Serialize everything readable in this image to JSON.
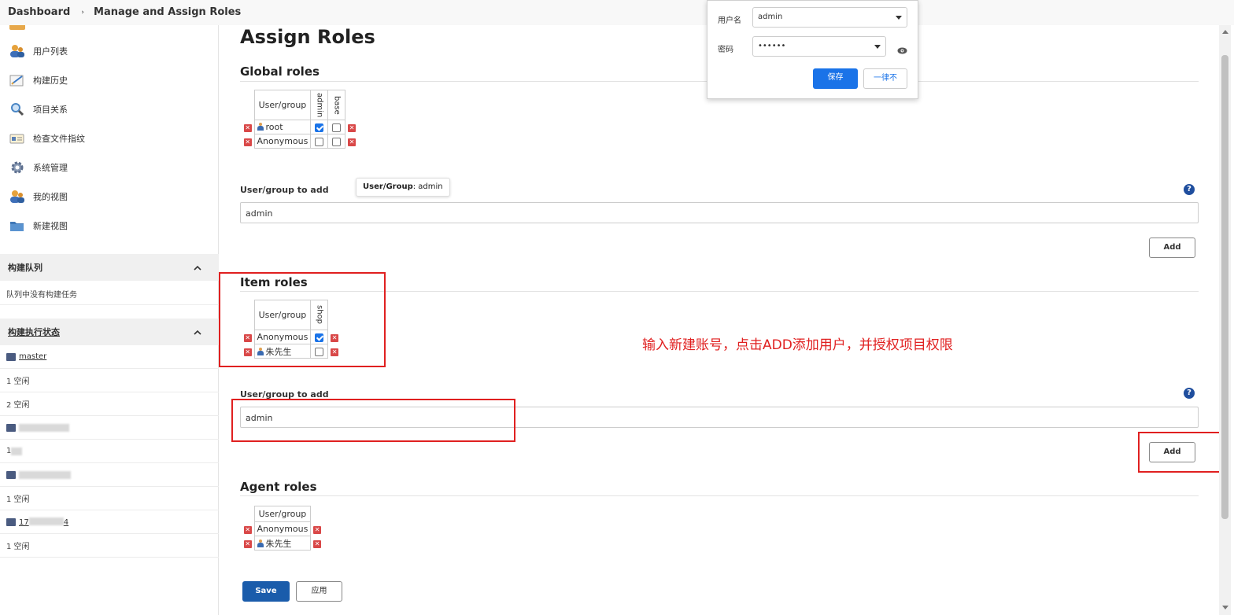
{
  "breadcrumb": {
    "dashboard": "Dashboard",
    "separator": "›",
    "current": "Manage and Assign Roles"
  },
  "sidebar": {
    "nav": [
      {
        "label": "用户列表",
        "icon": "users-icon"
      },
      {
        "label": "构建历史",
        "icon": "notepad-icon"
      },
      {
        "label": "项目关系",
        "icon": "search-icon"
      },
      {
        "label": "检查文件指纹",
        "icon": "fingerprint-icon"
      },
      {
        "label": "系统管理",
        "icon": "gear-icon"
      },
      {
        "label": "我的视图",
        "icon": "users-icon"
      },
      {
        "label": "新建视图",
        "icon": "folder-icon"
      }
    ],
    "build_queue": {
      "title": "构建队列",
      "empty": "队列中没有构建任务"
    },
    "executors": {
      "title": "构建执行状态",
      "master": "master",
      "rows": [
        "1 空闲",
        "2 空闲",
        "1 ",
        "1 空闲",
        "17",
        "4",
        "1 空闲"
      ]
    }
  },
  "page": {
    "title": "Assign Roles"
  },
  "global_roles": {
    "heading": "Global roles",
    "col_user": "User/group",
    "roles": [
      "admin",
      "base"
    ],
    "rows": [
      {
        "name": "root",
        "checks": [
          true,
          false
        ]
      },
      {
        "name": "Anonymous",
        "checks": [
          false,
          false
        ]
      }
    ],
    "add_label": "User/group to add",
    "add_value": "admin",
    "add_button": "Add",
    "help": "?"
  },
  "tooltip": {
    "key": "User/Group",
    "value": ": admin"
  },
  "item_roles": {
    "heading": "Item roles",
    "col_user": "User/group",
    "roles": [
      "shop"
    ],
    "rows": [
      {
        "name": "Anonymous",
        "checks": [
          true
        ]
      },
      {
        "name": "朱先生",
        "checks": [
          false
        ]
      }
    ],
    "add_label": "User/group to add",
    "add_value": "admin",
    "add_button": "Add",
    "help": "?"
  },
  "annotation": "输入新建账号，点击ADD添加用户，并授权项目权限",
  "agent_roles": {
    "heading": "Agent roles",
    "col_user": "User/group",
    "rows": [
      {
        "name": "Anonymous"
      },
      {
        "name": "朱先生"
      }
    ]
  },
  "footer": {
    "save": "Save",
    "apply": "应用"
  },
  "password_popup": {
    "username_label": "用户名",
    "username_value": "admin",
    "password_label": "密码",
    "password_value": "••••••",
    "save": "保存",
    "never": "一律不"
  },
  "colors": {
    "primary": "#1a5cab",
    "annotation_red": "#e02020",
    "checkbox_blue": "#1a73e8"
  }
}
